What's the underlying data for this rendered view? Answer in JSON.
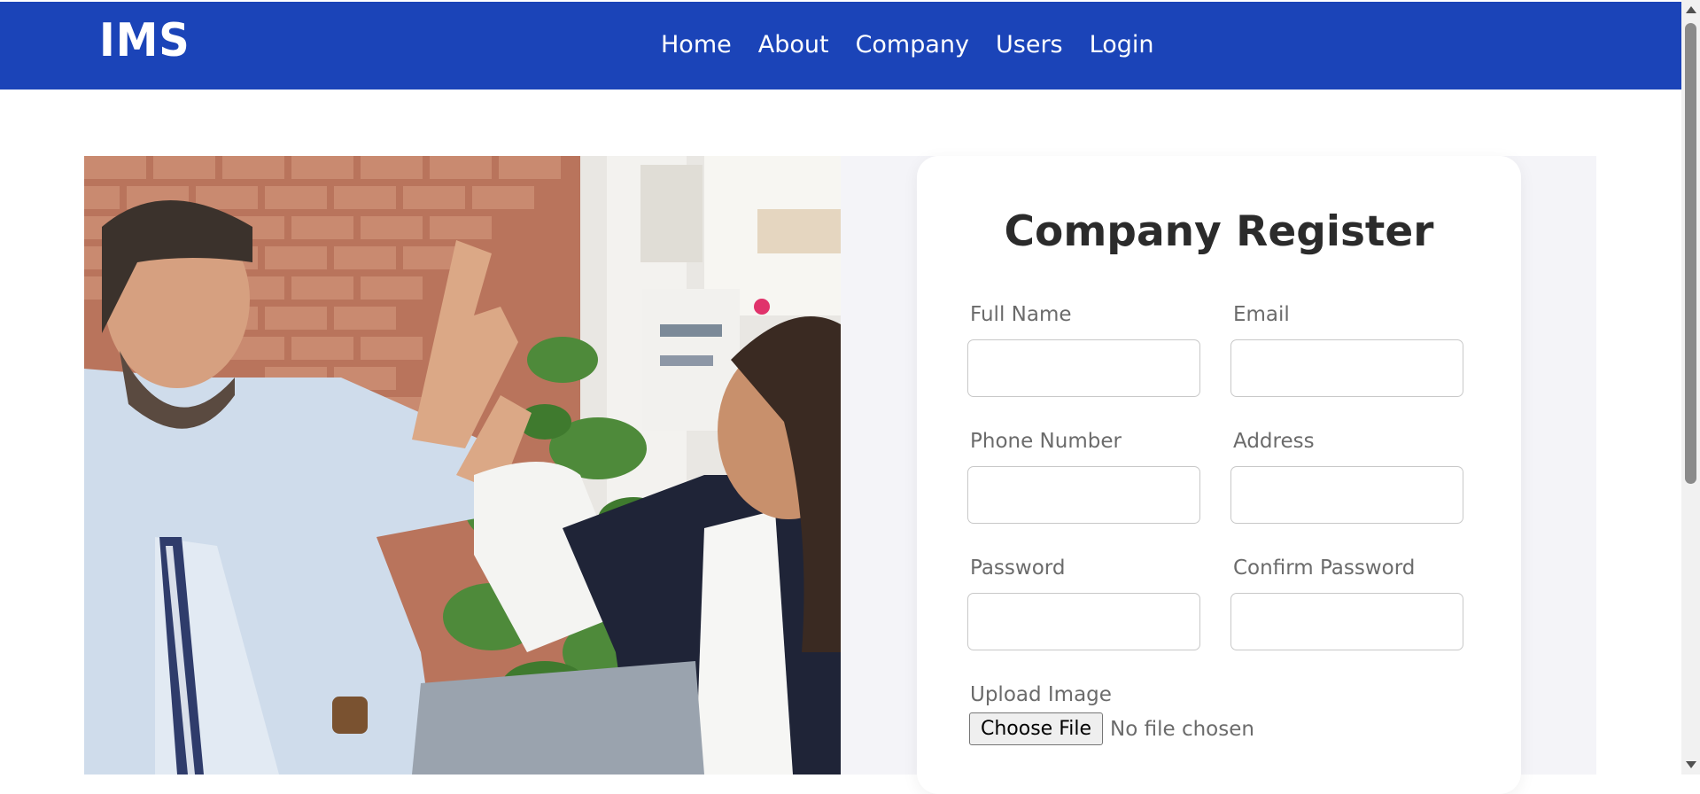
{
  "navbar": {
    "brand": "IMS",
    "links": [
      {
        "label": "Home"
      },
      {
        "label": "About"
      },
      {
        "label": "Company"
      },
      {
        "label": "Users"
      },
      {
        "label": "Login"
      }
    ]
  },
  "form": {
    "title": "Company Register",
    "fields": {
      "full_name": {
        "label": "Full Name",
        "value": ""
      },
      "email": {
        "label": "Email",
        "value": ""
      },
      "phone": {
        "label": "Phone Number",
        "value": ""
      },
      "address": {
        "label": "Address",
        "value": ""
      },
      "password": {
        "label": "Password",
        "value": ""
      },
      "confirm_password": {
        "label": "Confirm Password",
        "value": ""
      }
    },
    "upload": {
      "label": "Upload Image",
      "button": "Choose File",
      "status": "No file chosen"
    }
  },
  "colors": {
    "navbar_bg": "#1b44b8",
    "panel_bg": "#f4f4f8",
    "title_text": "#2b2b2b",
    "label_text": "#6b6b6b"
  }
}
